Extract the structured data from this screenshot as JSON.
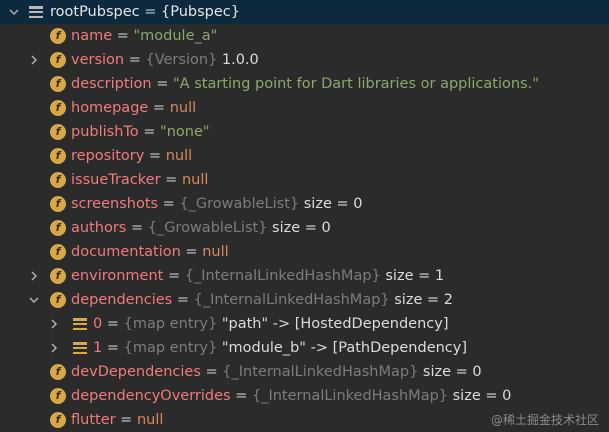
{
  "root": {
    "name": "rootPubspec",
    "eq": " = ",
    "value": "{Pubspec}"
  },
  "rows": [
    {
      "name": "name",
      "value": "\"module_a\""
    },
    {
      "name": "version",
      "type": "{Version}",
      "value": "1.0.0"
    },
    {
      "name": "description",
      "value": "\"A starting point for Dart libraries or applications.\""
    },
    {
      "name": "homepage",
      "value": "null"
    },
    {
      "name": "publishTo",
      "value": "\"none\""
    },
    {
      "name": "repository",
      "value": "null"
    },
    {
      "name": "issueTracker",
      "value": "null"
    },
    {
      "name": "screenshots",
      "type": "{_GrowableList}",
      "value": "size = 0"
    },
    {
      "name": "authors",
      "type": "{_GrowableList}",
      "value": "size = 0"
    },
    {
      "name": "documentation",
      "value": "null"
    },
    {
      "name": "environment",
      "type": "{_InternalLinkedHashMap}",
      "value": "size = 1"
    },
    {
      "name": "dependencies",
      "type": "{_InternalLinkedHashMap}",
      "value": "size = 2"
    },
    {
      "name": "0",
      "type": "{map entry}",
      "value": "\"path\" -> [HostedDependency]"
    },
    {
      "name": "1",
      "type": "{map entry}",
      "value": "\"module_b\" -> [PathDependency]"
    },
    {
      "name": "devDependencies",
      "type": "{_InternalLinkedHashMap}",
      "value": "size = 0"
    },
    {
      "name": "dependencyOverrides",
      "type": "{_InternalLinkedHashMap}",
      "value": "size = 0"
    },
    {
      "name": "flutter",
      "value": "null"
    }
  ],
  "eq": " = ",
  "icons": {
    "field": "f",
    "field_icon": "field-icon",
    "list_icon": "list-icon",
    "map_entry_icon": "map-entry-icon"
  },
  "colors": {
    "background": "#2b2b2b",
    "selection": "#0d293e",
    "field_name": "#f07b7b",
    "string": "#8aa96b",
    "keyword": "#d8895a",
    "type": "#7c7c7c",
    "field_icon": "#d6a84a"
  },
  "watermark": "@稀土掘金技术社区"
}
